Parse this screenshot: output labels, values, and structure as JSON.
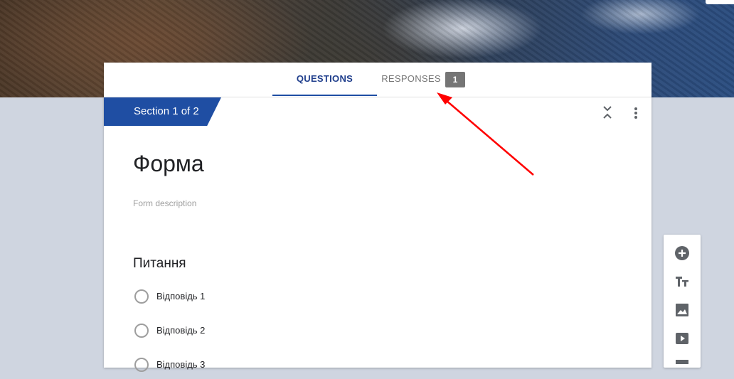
{
  "tabs": {
    "questions": "QUESTIONS",
    "responses": "RESPONSES",
    "responses_count": "1"
  },
  "section": {
    "label": "Section 1 of 2"
  },
  "form": {
    "title": "Форма",
    "description_placeholder": "Form description"
  },
  "question": {
    "title": "Питання",
    "options": [
      "Відповідь 1",
      "Відповідь 2",
      "Відповідь 3"
    ]
  },
  "toolbar": {
    "icons": [
      "add-question-icon",
      "add-title-icon",
      "add-image-icon",
      "add-video-icon",
      "add-section-icon"
    ]
  },
  "colors": {
    "accent": "#1f4ea3",
    "background": "#cfd5e0",
    "annotation_arrow": "#ff0000"
  }
}
